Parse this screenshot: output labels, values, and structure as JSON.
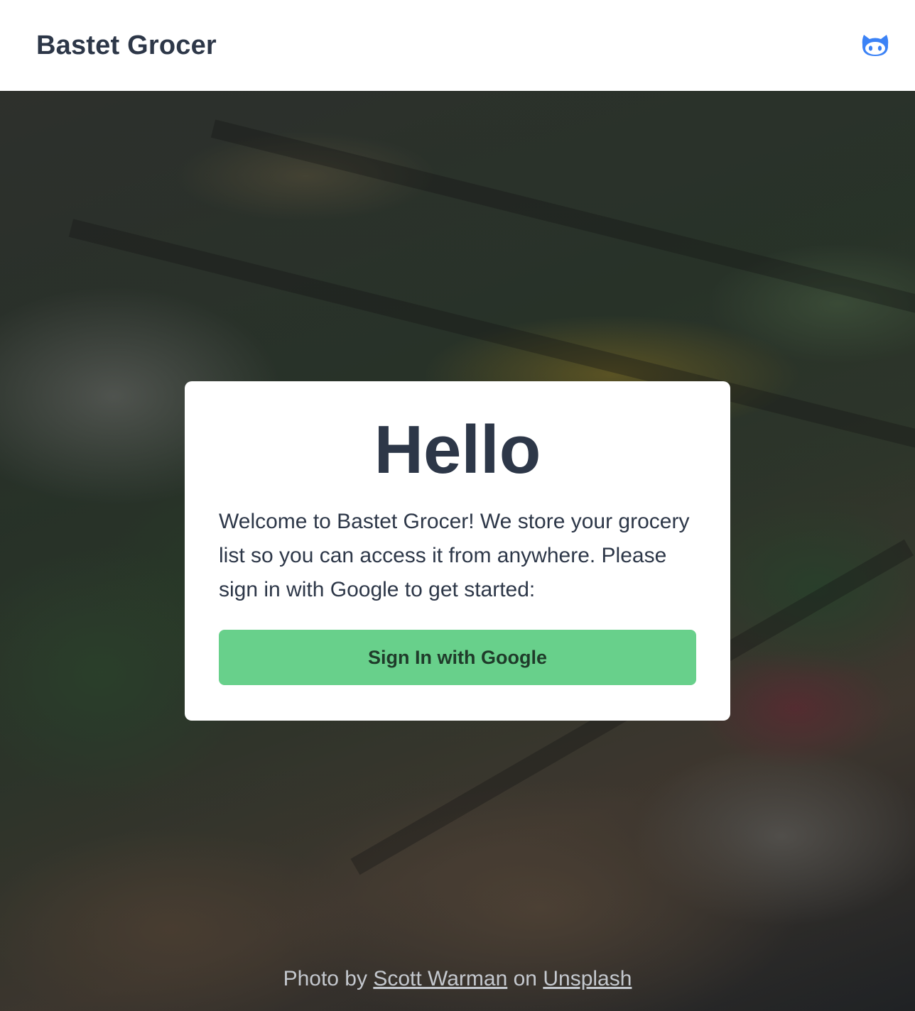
{
  "header": {
    "brand": "Bastet Grocer"
  },
  "card": {
    "title": "Hello",
    "message": "Welcome to Bastet Grocer! We store your grocery list so you can access it from anywhere. Please sign in with Google to get started:",
    "sign_in_label": "Sign In with Google"
  },
  "credit": {
    "prefix": "Photo by",
    "author": "Scott Warman",
    "middle": "on",
    "source": "Unsplash"
  },
  "colors": {
    "text": "#2d3748",
    "icon": "#3b82f6",
    "button": "#68d08b"
  },
  "icons": {
    "github": "github-octocat-icon"
  }
}
